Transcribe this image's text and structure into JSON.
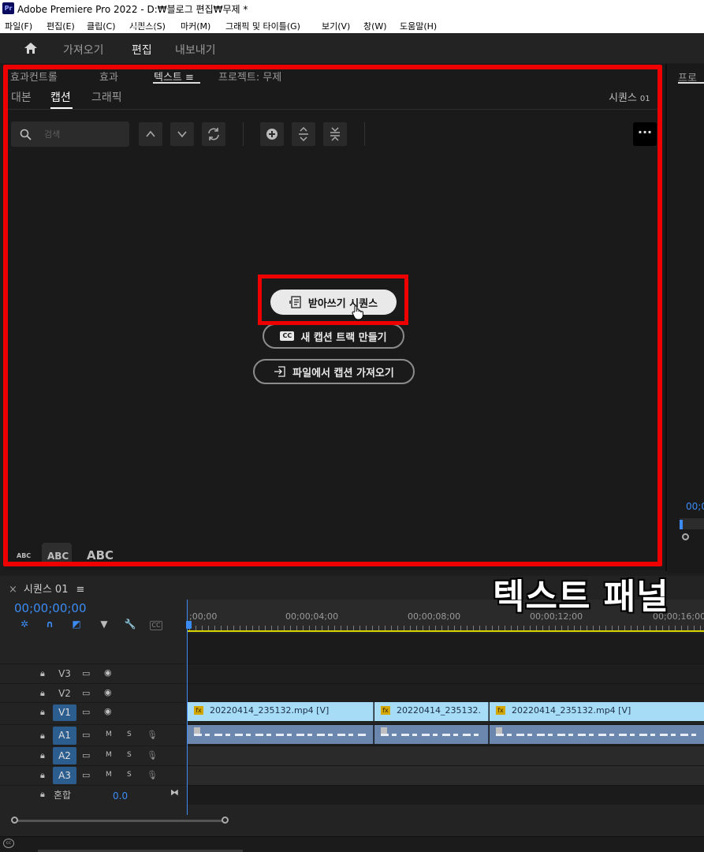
{
  "window": {
    "app_badge": "Pr",
    "title": "Adobe Premiere Pro 2022 - D:₩블로그 편집₩무제 *"
  },
  "menubar": [
    "파일(F)",
    "편집(E)",
    "클립(C)",
    "시퀀스(S)",
    "마커(M)",
    "그래픽 및 타이틀(G)",
    "보기(V)",
    "창(W)",
    "도움말(H)"
  ],
  "workspace": {
    "tabs": [
      "가져오기",
      "편집",
      "내보내기"
    ],
    "active": "편집"
  },
  "text_panel": {
    "tabs": [
      "효과컨트롤",
      "효과",
      "텍스트 ≡",
      "프로젝트: 무제"
    ],
    "active_tab": "텍스트 ≡",
    "subtabs": [
      "대본",
      "캡션",
      "그래픽"
    ],
    "active_subtab": "캡션",
    "sequence_label": "시퀀스",
    "sequence_number": "01",
    "search_placeholder": "검색",
    "actions": {
      "transcribe": "받아쓰기 시퀀스",
      "new_caption_track": "새 캡션 트랙 만들기",
      "import_captions": "파일에서 캡션 가져오기"
    },
    "font_sizes": [
      "ABC",
      "ABC",
      "ABC"
    ],
    "highlight_color": "#ee0000"
  },
  "right_panel": {
    "tab_label": "프로",
    "timecode": "00;0"
  },
  "overlay_caption": "텍스트 패널",
  "timeline": {
    "sequence_title": "시퀀스 01",
    "timecode": "00;00;00;00",
    "ruler": [
      ";00;00",
      "00;00;04;00",
      "00;00;08;00",
      "00;00;12;00",
      "00;00;16;00"
    ],
    "tracks": {
      "video": [
        "V3",
        "V2",
        "V1"
      ],
      "audio": [
        "A1",
        "A2",
        "A3"
      ],
      "mix_label": "혼합",
      "mix_value": "0.0",
      "m_label": "M",
      "s_label": "S"
    },
    "clips": [
      {
        "name": "20220414_235132.mp4 [V]"
      },
      {
        "name": "20220414_235132."
      },
      {
        "name": "20220414_235132.mp4 [V]"
      }
    ]
  }
}
